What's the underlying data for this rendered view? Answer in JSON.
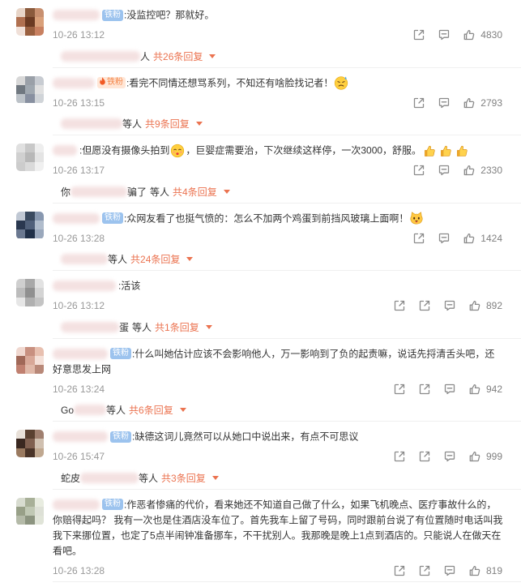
{
  "colors": {
    "reply_link": "#eb7350",
    "fan_badge": "#9cc3ee"
  },
  "comments": [
    {
      "badge": {
        "label": "铁粉"
      },
      "lines": [
        [
          ":没监控吧？那就好。"
        ]
      ],
      "time": "10-26 13:12",
      "actions": [
        "share-icon",
        "comment-icon",
        "like-icon"
      ],
      "likes": "4830",
      "reply": {
        "who": "人",
        "count": "共26条回复"
      }
    },
    {
      "badge": {
        "label": "铁粉",
        "icon": "fire-icon"
      },
      "lines": [
        [
          ":看完不同情还想骂系列，不知还有啥脸找记者！",
          {
            "emoji": "sweat-face"
          }
        ]
      ],
      "time": "10-26 13:15",
      "actions": [
        "share-icon",
        "comment-icon",
        "like-icon"
      ],
      "likes": "2793",
      "reply": {
        "who": "等人",
        "count": "共9条回复"
      }
    },
    {
      "badge": null,
      "lines": [
        [
          ":但愿没有摄像头拍到",
          {
            "emoji": "kissing-face"
          },
          "，巨婴症需要治，下次继续这样停，一次3000，舒服。",
          {
            "emoji": "thumbs-up"
          },
          {
            "emoji": "thumbs-up"
          },
          {
            "emoji": "thumbs-up"
          }
        ]
      ],
      "time": "10-26 13:17",
      "actions": [
        "share-icon",
        "comment-icon",
        "like-icon"
      ],
      "likes": "2330",
      "reply": {
        "lead": "你",
        "tail": "骗了",
        "who": "等人",
        "count": "共4条回复"
      }
    },
    {
      "badge": {
        "label": "铁粉"
      },
      "lines": [
        [
          ":众网友看了也挺气愤的：怎么不加两个鸡蛋到前挡风玻璃上面啊！",
          {
            "emoji": "cat-face"
          }
        ]
      ],
      "time": "10-26 13:28",
      "actions": [
        "share-icon",
        "comment-icon",
        "like-icon"
      ],
      "likes": "1424",
      "reply": {
        "who": "等人",
        "count": "共24条回复"
      }
    },
    {
      "badge": null,
      "lines": [
        [
          ":活该"
        ]
      ],
      "time": "10-26 13:12",
      "actions": [
        "repost-icon",
        "share-icon",
        "comment-icon",
        "like-icon"
      ],
      "likes": "892",
      "reply": {
        "tail": "蛋",
        "who": "等人",
        "count": "共1条回复"
      }
    },
    {
      "badge": {
        "label": "铁粉"
      },
      "lines": [
        [
          ":什么叫她估计应该不会影响他人，万一影响到了负的起责嘛，说话先捋清舌头吧，还"
        ],
        [
          "好意思发上网"
        ]
      ],
      "time": "10-26 13:24",
      "actions": [
        "repost-icon",
        "share-icon",
        "comment-icon",
        "like-icon"
      ],
      "likes": "942",
      "reply": {
        "lead": "Go",
        "who": "等人",
        "count": "共6条回复"
      }
    },
    {
      "badge": {
        "label": "铁粉"
      },
      "lines": [
        [
          ":缺德这词儿竟然可以从她口中说出来，有点不可思议"
        ]
      ],
      "time": "10-26 15:47",
      "actions": [
        "repost-icon",
        "share-icon",
        "comment-icon",
        "like-icon"
      ],
      "likes": "999",
      "reply": {
        "lead": "蛇皮",
        "who": "等人",
        "count": "共3条回复"
      }
    },
    {
      "badge": {
        "label": "铁粉"
      },
      "lines": [
        [
          ":作恶者惨痛的代价，看来她还不知道自己做了什么，如果飞机晚点、医疗事故什么的，"
        ],
        [
          "你赔得起吗？ 我有一次也是住酒店没车位了。首先我车上留了号码，同时跟前台说了有位置随时电话叫我"
        ],
        [
          "我下来挪位置，也定了5点半闹钟准备挪车，不干扰别人。我那晚是晚上1点到酒店的。只能说人在做天在"
        ],
        [
          "看吧。"
        ]
      ],
      "time": "10-26 13:28",
      "actions": [
        "repost-icon",
        "share-icon",
        "comment-icon",
        "like-icon"
      ],
      "likes": "819",
      "reply": null
    }
  ]
}
